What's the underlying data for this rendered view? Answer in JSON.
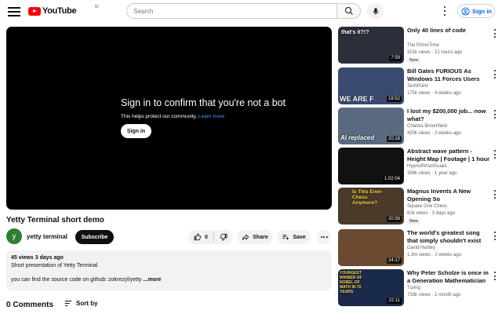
{
  "header": {
    "logo_text": "YouTube",
    "logo_region": "IE",
    "search_placeholder": "Search",
    "signin_label": "Sign in"
  },
  "player": {
    "title": "Sign in to confirm that you're not a bot",
    "subtitle": "This helps protect our community.",
    "learn_more": "Learn more",
    "signin_button": "Sign in"
  },
  "video": {
    "title": "Yetty Terminal short demo",
    "channel_initial": "y",
    "channel_name": "yetty terminal",
    "subscribe_label": "Subscribe",
    "like_count": "0",
    "share_label": "Share",
    "save_label": "Save"
  },
  "description": {
    "meta": "45 views  3 days ago",
    "line1": "Short presentation of Yetty Terminal",
    "line2": "you can find the source code on github: zokrezyl/yetty",
    "more": "...more"
  },
  "comments": {
    "count": "0 Comments",
    "sort_label": "Sort by"
  },
  "colors": {
    "brand_red": "#ff0000",
    "link_blue": "#065fd4",
    "player_bg": "#000000"
  },
  "recommendations": [
    {
      "title": "Only 40 lines of code",
      "channel": "The PrimeTime",
      "stats": "321k views · 21 hours ago",
      "duration": "7:59",
      "badge": "New",
      "thumb_text": "that's it?!?",
      "thumb_bg": "#2a2f3a"
    },
    {
      "title": "Bill Gates FURIOUS As Windows 11 Forces Users To...",
      "channel": "TechPoint",
      "stats": "175k views · 4 weeks ago",
      "duration": "18:52",
      "badge": "",
      "thumb_text": "WE ARE F",
      "thumb_bg": "#3a4a70"
    },
    {
      "title": "I lost my $200,000 job... now what?",
      "channel": "Charles Broomfield",
      "stats": "420k views · 2 weeks ago",
      "duration": "20:18",
      "badge": "",
      "thumb_text": "AI replaced",
      "thumb_bg": "#5a6a80"
    },
    {
      "title": "Abstract wave pattern - Height Map | Footage | 1 hour 4k...",
      "channel": "HypnoRimaVisuals",
      "stats": "399k views · 1 year ago",
      "duration": "1:02:04",
      "badge": "",
      "thumb_text": "",
      "thumb_bg": "#111111"
    },
    {
      "title": "Magnus Invents A New Opening So OUTRAGEOUS,...",
      "channel": "Square One Chess",
      "stats": "62k views · 3 days ago",
      "duration": "20:56",
      "badge": "New",
      "thumb_text": "Is This Even Chess Anymore?",
      "thumb_bg": "#4a3a2a"
    },
    {
      "title": "The world's greatest song that simply shouldn't exist",
      "channel": "David Hartley",
      "stats": "1.3m views · 2 weeks ago",
      "duration": "24:17",
      "badge": "",
      "thumb_text": "",
      "thumb_bg": "#6a4a30"
    },
    {
      "title": "Why Peter Scholze is once in a Generation Mathematician",
      "channel": "Turing",
      "stats": "733k views · 1 month ago",
      "duration": "22:11",
      "badge": "",
      "thumb_text": "YOUNGEST WINNER OF NOBEL OF MATH IN 70 YEARS",
      "thumb_bg": "#1a2a4a"
    }
  ]
}
